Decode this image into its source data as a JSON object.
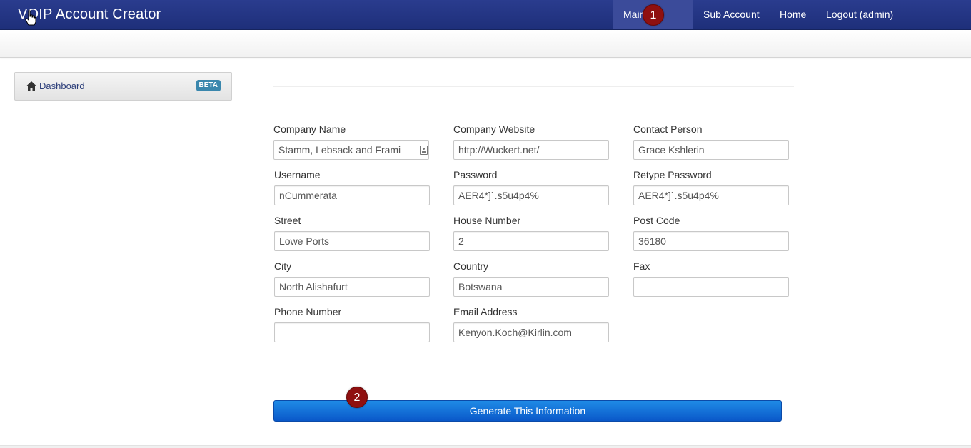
{
  "navbar": {
    "brand": "VOIP Account Creator",
    "items": [
      {
        "label": "Main Account",
        "active": true
      },
      {
        "label": "Sub Account",
        "active": false
      },
      {
        "label": "Home",
        "active": false
      },
      {
        "label": "Logout (admin)",
        "active": false
      }
    ]
  },
  "sidebar": {
    "item": {
      "label": "Dashboard",
      "badge": "BETA",
      "icon": "home-icon"
    }
  },
  "form": {
    "company_name": {
      "label": "Company Name",
      "value": "Stamm, Lebsack and Frami"
    },
    "company_website": {
      "label": "Company Website",
      "value": "http://Wuckert.net/"
    },
    "contact_person": {
      "label": "Contact Person",
      "value": "Grace Kshlerin"
    },
    "username": {
      "label": "Username",
      "value": "nCummerata"
    },
    "password": {
      "label": "Password",
      "value": "AER4*]`.s5u4p4%"
    },
    "retype_password": {
      "label": "Retype Password",
      "value": "AER4*]`.s5u4p4%"
    },
    "street": {
      "label": "Street",
      "value": "Lowe Ports"
    },
    "house_number": {
      "label": "House Number",
      "value": "2"
    },
    "post_code": {
      "label": "Post Code",
      "value": "36180"
    },
    "city": {
      "label": "City",
      "value": "North Alishafurt"
    },
    "country": {
      "label": "Country",
      "value": "Botswana"
    },
    "fax": {
      "label": "Fax",
      "value": ""
    },
    "phone_number": {
      "label": "Phone Number",
      "value": ""
    },
    "email_address": {
      "label": "Email Address",
      "value": "Kenyon.Koch@Kirlin.com"
    },
    "submit_label": "Generate This Information"
  },
  "markers": {
    "first": "1",
    "second": "2"
  },
  "colors": {
    "navbar": "#23358a",
    "button": "#1570d8",
    "badge": "#3a87ad",
    "marker": "#8f1010"
  }
}
